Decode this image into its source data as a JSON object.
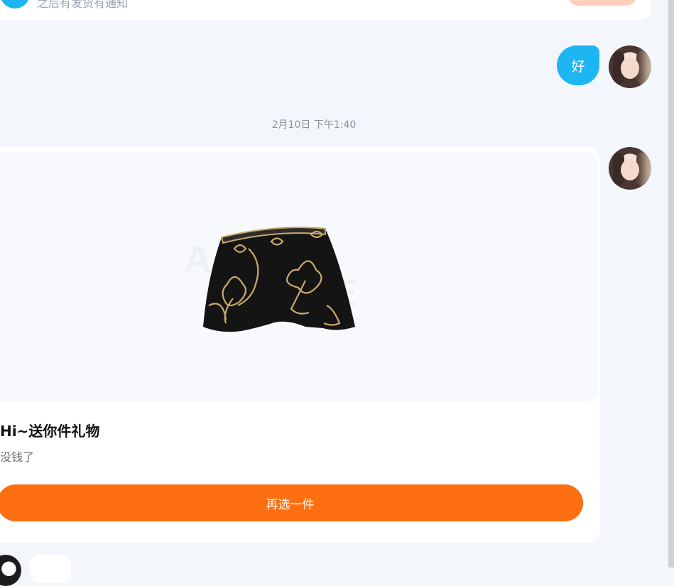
{
  "top_message": {
    "text": "之后有发货有通知"
  },
  "reply_message": {
    "text": "好"
  },
  "timestamp": "2月10日 下午1:40",
  "gift_card": {
    "title": "Hi~送你件礼物",
    "subtitle": "没钱了",
    "button_label": "再选一件",
    "image_icon": "black-floral-shorts-image"
  },
  "colors": {
    "page_bg": "#f3f6fa",
    "bubble_blue": "#1eb5f3",
    "button_orange": "#fe6f12",
    "card_bg": "#ffffff"
  }
}
